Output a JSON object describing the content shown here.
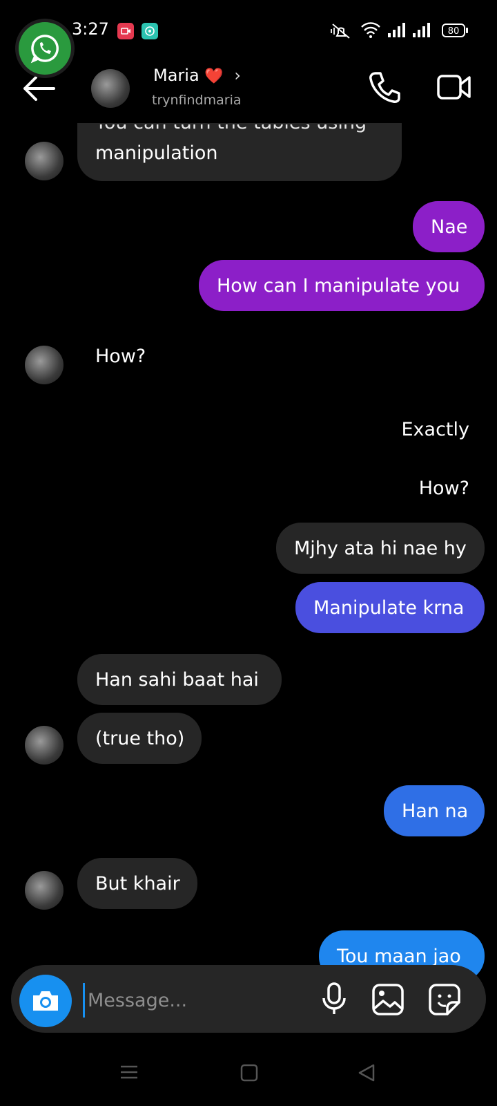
{
  "status_bar": {
    "time": "3:27",
    "battery": "80",
    "icons": [
      "video-recorder-icon",
      "chat-notification-icon",
      "mute-icon",
      "wifi-icon",
      "signal-icon",
      "signal-icon",
      "battery-icon"
    ]
  },
  "overlay": {
    "icon": "whatsapp-icon"
  },
  "header": {
    "name": "Maria",
    "heart": "❤️",
    "username": "trynfindmaria"
  },
  "messages": [
    {
      "text_line1": "You can turn the tables using",
      "text_line2": "manipulation",
      "side": "in"
    },
    {
      "text": "Nae",
      "side": "out"
    },
    {
      "text": "How can I manipulate you",
      "side": "out"
    },
    {
      "text": "How?",
      "side": "in"
    },
    {
      "text": "Exactly",
      "side": "out"
    },
    {
      "text": "How?",
      "side": "out"
    },
    {
      "text": "Mjhy ata hi nae hy",
      "side": "out"
    },
    {
      "text": "Manipulate krna",
      "side": "out"
    },
    {
      "text": "Han sahi baat hai",
      "side": "in"
    },
    {
      "text": "(true tho)",
      "side": "in"
    },
    {
      "text": "Han na",
      "side": "out"
    },
    {
      "text": "But khair",
      "side": "in"
    },
    {
      "text": "Tou maan jao",
      "side": "out"
    }
  ],
  "composer": {
    "placeholder": "Message..."
  },
  "colors": {
    "purple": "#8c1fc8",
    "violet": "#6b3fd8",
    "indigo": "#4a4fdf",
    "blue": "#2f6fe6",
    "incoming": "#262626",
    "camera": "#1790f0"
  }
}
